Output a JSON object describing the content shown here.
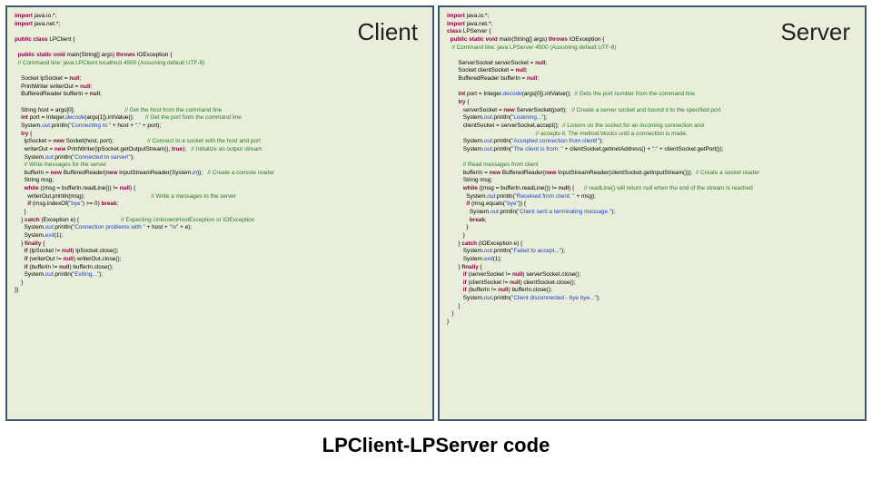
{
  "footer": "LPClient-LPServer code",
  "left": {
    "title": "Client",
    "code_html": "<span class='kw'>import</span> java.io.*;\n<span class='kw'>import</span> java.net.*;\n\n<span class='kw'>public class</span> LPClient {\n\n  <span class='kw'>public static void</span> main(String[] args) <span class='kw'>throws</span> IOException {\n  <span class='cm'>// Command line: java LPClient localhost 4500 (Assuming default UTF-8)</span>\n\n    Socket lpSocket = <span class='kw'>null</span>;\n    PrintWriter writerOut = <span class='kw'>null</span>;\n    BufferedReader bufferIn = <span class='kw'>null</span>;\n\n    String host = args[0];                               <span class='cm'>// Get the host from the command line</span>\n    <span class='kw'>int</span> port = Integer.<span class='st'>decode</span>(args[1]).intValue();       <span class='cm'>// Get the port from the command line</span>\n    System.<span class='st'>out</span>.println(<span class='str'>\"Connecting to \"</span> + host + <span class='str'>\":\"</span> + port);\n    <span class='kw'>try</span> {\n      lpSocket = <span class='kw'>new</span> Socket(host, port);                     <span class='cm'>// Connect to a socket with the host and port</span>\n      writerOut = <span class='kw'>new</span> PrintWriter(lpSocket.getOutputStream(), <span class='kw'>true</span>);   <span class='cm'>// Initialize an output stream</span>\n      System.<span class='st'>out</span>.println(<span class='str'>\"Connected to server!\"</span>);\n      <span class='cm'>// Write messages for the server</span>\n      bufferIn = <span class='kw'>new</span> BufferedReader(<span class='kw'>new</span> InputStreamReader(System.<span class='st'>in</span>));   <span class='cm'>// Create a console reader</span>\n      String msg;\n      <span class='kw'>while</span> ((msg = bufferIn.readLine()) != <span class='kw'>null</span>) {\n        writerOut.println(msg);                                         <span class='cm'>// Write a messages to the server</span>\n        <span class='kw'>if</span> (msg.indexOf(<span class='str'>\"bye\"</span>) &gt;= 0) <span class='kw'>break</span>;\n      }\n    } <span class='kw'>catch</span> (Exception e) {                          <span class='cm'>// Expecting UnknownHostException or IOException</span>\n      System.<span class='st'>out</span>.println(<span class='str'>\"Connection problems with \"</span> + host + <span class='str'>\"\\n\"</span> + e);\n      System.<span class='st'>exit</span>(1);\n    } <span class='kw'>finally</span> {\n      <span class='kw'>if</span> (lpSocket != <span class='kw'>null</span>) lpSocket.close();\n      <span class='kw'>if</span> (writerOut != <span class='kw'>null</span>) writerOut.close();\n      <span class='kw'>if</span> (bufferIn != <span class='kw'>null</span>) bufferIn.close();\n      System.<span class='st'>out</span>.println(<span class='str'>\"Exiting...\"</span>);\n    }\n}}"
  },
  "right": {
    "title": "Server",
    "code_html": "<span class='kw'>import</span> java.io.*;\n<span class='kw'>import</span> java.net.*;\n<span class='kw'>class</span> LPServer {\n  <span class='kw'>public static void</span> main(String[] args) <span class='kw'>throws</span> IOException {\n   <span class='cm'>// Command line: java LPServer 4500 (Assuming default UTF-8)</span>\n\n       ServerSocket serverSocket = <span class='kw'>null</span>;\n       Socket clientSocket = <span class='kw'>null</span>;\n       BufferedReader bufferIn = <span class='kw'>null</span>;\n\n       <span class='kw'>int</span> port = Integer.<span class='st'>decode</span>(args[0]).intValue();  <span class='cm'>// Gets the port number from the command line</span>\n       <span class='kw'>try</span> {\n          serverSocket = <span class='kw'>new</span> ServerSocket(port);   <span class='cm'>// Create a server socket and bound it to the specified port</span>\n          System.<span class='st'>out</span>.println(<span class='str'>\"Listening...\"</span>);\n          clientSocket = serverSocket.accept();  <span class='cm'>// Listens on the socket for an incoming connection and</span>\n                                                       <span class='cm'>// accepts it. The method blocks until a connection is made.</span>\n          System.<span class='st'>out</span>.println(<span class='str'>\"Accepted connection from client!\"</span>);\n          System.<span class='st'>out</span>.println(<span class='str'>\"The client is from: \"</span> + clientSocket.getInetAddress() + <span class='str'>\":\"</span> + clientSocket.getPort());\n\n          <span class='cm'>// Read messages from client</span>\n          bufferIn = <span class='kw'>new</span> BufferedReader(<span class='kw'>new</span> InputStreamReader(clientSocket.getInputStream()));  <span class='cm'>// Create a socket reader</span>\n          String msg;\n          <span class='kw'>while</span> ((msg = bufferIn.readLine()) != <span class='kw'>null</span>) {      <span class='cm'>// readLine() will return null when the end of the stream is reached</span>\n            System.<span class='st'>out</span>.println(<span class='str'>\"Received from client: \"</span> + msg);\n            <span class='kw'>if</span> (msg.equals(<span class='str'>\"bye\"</span>)) {\n              System.<span class='st'>out</span>.println(<span class='str'>\"Client sent a terminating message.\"</span>);\n              <span class='kw'>break</span>;\n            }\n          }\n       } <span class='kw'>catch</span> (IOException e) {\n          System.<span class='st'>out</span>.println(<span class='str'>\"Failed to accept...\"</span>);\n          System.<span class='st'>exit</span>(1);\n       } <span class='kw'>finally</span> {\n          <span class='kw'>if</span> (serverSocket != <span class='kw'>null</span>) serverSocket.close();\n          <span class='kw'>if</span> (clientSocket != <span class='kw'>null</span>) clientSocket.close();\n          <span class='kw'>if</span> (bufferIn != <span class='kw'>null</span>) bufferIn.close();\n          System.<span class='st'>out</span>.println(<span class='str'>\"Client disconnected - bye bye...\"</span>);\n       }\n   }\n}"
  }
}
